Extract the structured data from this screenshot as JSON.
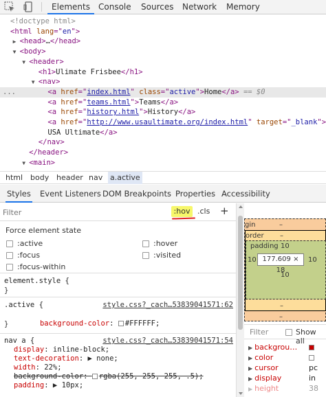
{
  "toolbar": {
    "tabs": [
      "Elements",
      "Console",
      "Sources",
      "Network",
      "Memory"
    ],
    "active_tab": "Elements",
    "icons": [
      "inspect-cursor-icon",
      "device-toolbar-icon"
    ]
  },
  "tree": {
    "lines": [
      {
        "indent": 0,
        "tri": "",
        "parts": [
          {
            "c": "dt",
            "t": "<!doctype html>"
          }
        ]
      },
      {
        "indent": 0,
        "tri": "",
        "parts": [
          {
            "c": "tg",
            "t": "<html "
          },
          {
            "c": "an",
            "t": "lang"
          },
          {
            "c": "tg",
            "t": "=\""
          },
          {
            "c": "av",
            "t": "en"
          },
          {
            "c": "tg",
            "t": "\">"
          }
        ]
      },
      {
        "indent": 1,
        "tri": "▶",
        "parts": [
          {
            "c": "tg",
            "t": "<head>"
          },
          {
            "c": "tx",
            "t": "…"
          },
          {
            "c": "tg",
            "t": "</head>"
          }
        ]
      },
      {
        "indent": 1,
        "tri": "▼",
        "parts": [
          {
            "c": "tg",
            "t": "<body>"
          }
        ]
      },
      {
        "indent": 2,
        "tri": "▼",
        "parts": [
          {
            "c": "tg",
            "t": "<header>"
          }
        ]
      },
      {
        "indent": 3,
        "tri": "",
        "parts": [
          {
            "c": "tg",
            "t": "<h1>"
          },
          {
            "c": "tx",
            "t": "Ulimate Frisbee"
          },
          {
            "c": "tg",
            "t": "</h1>"
          }
        ]
      },
      {
        "indent": 3,
        "tri": "▼",
        "parts": [
          {
            "c": "tg",
            "t": "<nav>"
          }
        ]
      },
      {
        "indent": 4,
        "tri": "",
        "sel": true,
        "parts": [
          {
            "c": "tg",
            "t": "<a "
          },
          {
            "c": "an",
            "t": "href"
          },
          {
            "c": "tg",
            "t": "=\""
          },
          {
            "c": "av u",
            "t": "index.html"
          },
          {
            "c": "tg",
            "t": "\" "
          },
          {
            "c": "an",
            "t": "class"
          },
          {
            "c": "tg",
            "t": "=\""
          },
          {
            "c": "av",
            "t": "active"
          },
          {
            "c": "tg",
            "t": "\">"
          },
          {
            "c": "tx",
            "t": "Home"
          },
          {
            "c": "tg",
            "t": "</a>"
          },
          {
            "c": "eq0",
            "t": " == $0"
          }
        ]
      },
      {
        "indent": 4,
        "tri": "",
        "parts": [
          {
            "c": "tg",
            "t": "<a "
          },
          {
            "c": "an",
            "t": "href"
          },
          {
            "c": "tg",
            "t": "=\""
          },
          {
            "c": "av u",
            "t": "teams.html"
          },
          {
            "c": "tg",
            "t": "\">"
          },
          {
            "c": "tx",
            "t": "Teams"
          },
          {
            "c": "tg",
            "t": "</a>"
          }
        ]
      },
      {
        "indent": 4,
        "tri": "",
        "parts": [
          {
            "c": "tg",
            "t": "<a "
          },
          {
            "c": "an",
            "t": "href"
          },
          {
            "c": "tg",
            "t": "=\""
          },
          {
            "c": "av u",
            "t": "history.html"
          },
          {
            "c": "tg",
            "t": "\">"
          },
          {
            "c": "tx",
            "t": "History"
          },
          {
            "c": "tg",
            "t": "</a>"
          }
        ]
      },
      {
        "indent": 4,
        "tri": "",
        "parts": [
          {
            "c": "tg",
            "t": "<a "
          },
          {
            "c": "an",
            "t": "href"
          },
          {
            "c": "tg",
            "t": "=\""
          },
          {
            "c": "av u",
            "t": "http://www.usaultimate.org/index.html"
          },
          {
            "c": "tg",
            "t": "\" "
          },
          {
            "c": "an",
            "t": "target"
          },
          {
            "c": "tg",
            "t": "=\""
          },
          {
            "c": "av",
            "t": "_blank"
          },
          {
            "c": "tg",
            "t": "\">"
          }
        ]
      },
      {
        "indent": 4,
        "tri": "",
        "parts": [
          {
            "c": "tx",
            "t": "USA Ultimate"
          },
          {
            "c": "tg",
            "t": "</a>"
          }
        ]
      },
      {
        "indent": 3,
        "tri": "",
        "parts": [
          {
            "c": "tg",
            "t": "</nav>"
          }
        ]
      },
      {
        "indent": 2,
        "tri": "",
        "parts": [
          {
            "c": "tg",
            "t": "</header>"
          }
        ]
      },
      {
        "indent": 2,
        "tri": "▼",
        "parts": [
          {
            "c": "tg",
            "t": "<main>"
          }
        ]
      }
    ],
    "gutter_dots": "..."
  },
  "breadcrumb": [
    "html",
    "body",
    "header",
    "nav",
    "a.active"
  ],
  "subtabs": [
    "Styles",
    "Event Listeners",
    "DOM Breakpoints",
    "Properties",
    "Accessibility"
  ],
  "styles": {
    "filter_placeholder": "Filter",
    "hov_label": ":hov",
    "cls_label": ".cls",
    "plus_label": "+",
    "force_title": "Force element state",
    "states": [
      ":active",
      ":hover",
      ":focus",
      ":visited",
      ":focus-within"
    ],
    "rules": [
      {
        "selector": "element.style {",
        "source": "",
        "decls": [],
        "close": "}"
      },
      {
        "selector": ".active {",
        "source": "style.css?_cach…53839041571:62",
        "decls": [
          {
            "prop": "background-color",
            "val": "#FFFFFF",
            "swatch": "#FFFFFF",
            "strike": false
          }
        ],
        "close": "}"
      },
      {
        "selector": "nav a {",
        "source": "style.css?_cach…53839041571:54",
        "decls": [
          {
            "prop": "display",
            "val": "inline-block",
            "strike": false
          },
          {
            "prop": "text-decoration",
            "val": "▶ none",
            "strike": false
          },
          {
            "prop": "width",
            "val": "22%",
            "strike": false
          },
          {
            "prop": "background-color",
            "val": "rgba(255, 255, 255, .5)",
            "swatch": "#ffffff",
            "strike": true
          },
          {
            "prop": "padding",
            "val": "▶ 10px",
            "strike": false
          }
        ],
        "close": ""
      }
    ]
  },
  "boxmodel": {
    "margin_label": "gin",
    "margin_top": "–",
    "border_label": "order",
    "border_top": "–",
    "padding_label": "padding",
    "padding_top": "10",
    "padding_left": "10",
    "padding_right": "10",
    "padding_bottom": "10",
    "content": "177.609 × 18",
    "border_bottom": "–",
    "margin_bottom": "–"
  },
  "computed": {
    "filter_label": "Filter",
    "show_all_label": "Show all",
    "rows": [
      {
        "prop": "backgrou…",
        "val": "",
        "swatch": "#c80000"
      },
      {
        "prop": "color",
        "val": "",
        "swatch": "#ffffff"
      },
      {
        "prop": "cursor",
        "val": "pc"
      },
      {
        "prop": "display",
        "val": "in"
      },
      {
        "prop": "height",
        "val": "38"
      }
    ]
  }
}
